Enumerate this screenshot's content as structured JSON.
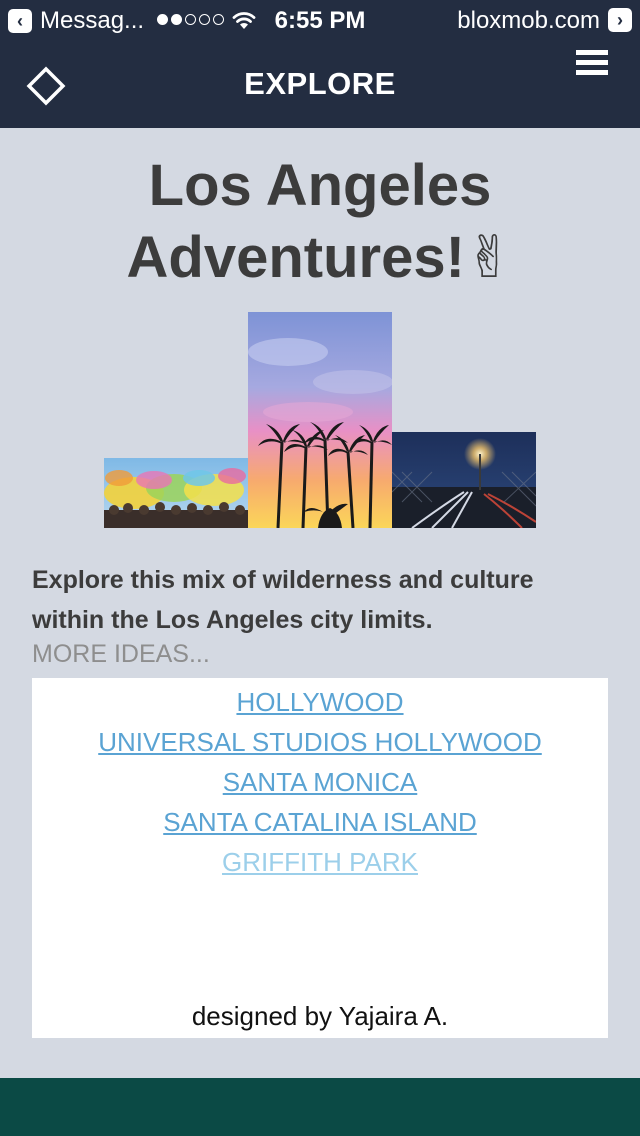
{
  "status_bar": {
    "back_app_label": "Messag...",
    "time": "6:55 PM",
    "site": "bloxmob.com",
    "signal_filled": 2,
    "signal_total": 5
  },
  "header": {
    "title": "EXPLORE"
  },
  "main": {
    "title_line1": "Los Angeles",
    "title_line2": "Adventures!✌",
    "description": "Explore this mix of wilderness and culture within the Los Angeles city limits.",
    "more_ideas": "MORE IDEAS..."
  },
  "links": [
    {
      "label": "HOLLYWOOD"
    },
    {
      "label": "UNIVERSAL STUDIOS HOLLYWOOD"
    },
    {
      "label": "SANTA MONICA"
    },
    {
      "label": "SANTA CATALINA ISLAND"
    },
    {
      "label": "GRIFFITH PARK"
    }
  ],
  "credit": "designed by Yajaira A.",
  "colors": {
    "header_bg": "#232d41",
    "page_bg": "#d4d9e2",
    "link": "#5aa3d3",
    "link_visited": "#9ccfea",
    "footer": "#0b4a45"
  }
}
